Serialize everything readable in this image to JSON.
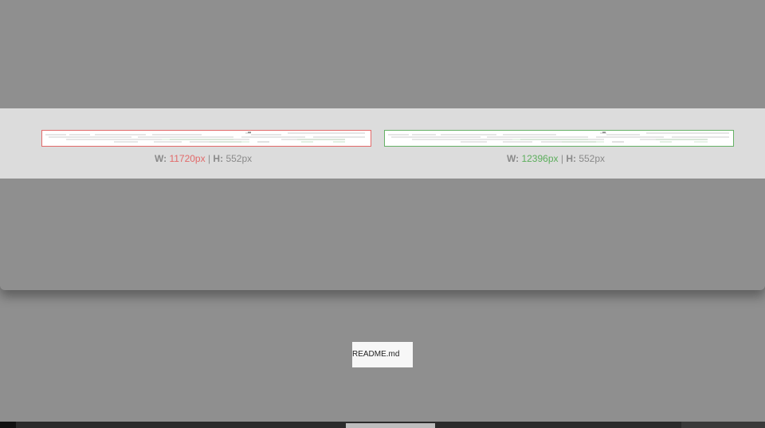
{
  "diff": {
    "left": {
      "w_label": "W:",
      "width_value": "11720px",
      "separator": "|",
      "h_label": "H:",
      "height_value": "552px",
      "border_color": "#e26a6a"
    },
    "right": {
      "w_label": "W:",
      "width_value": "12396px",
      "separator": "|",
      "h_label": "H:",
      "height_value": "552px",
      "border_color": "#66b166"
    }
  },
  "file": {
    "name": "README.md"
  }
}
